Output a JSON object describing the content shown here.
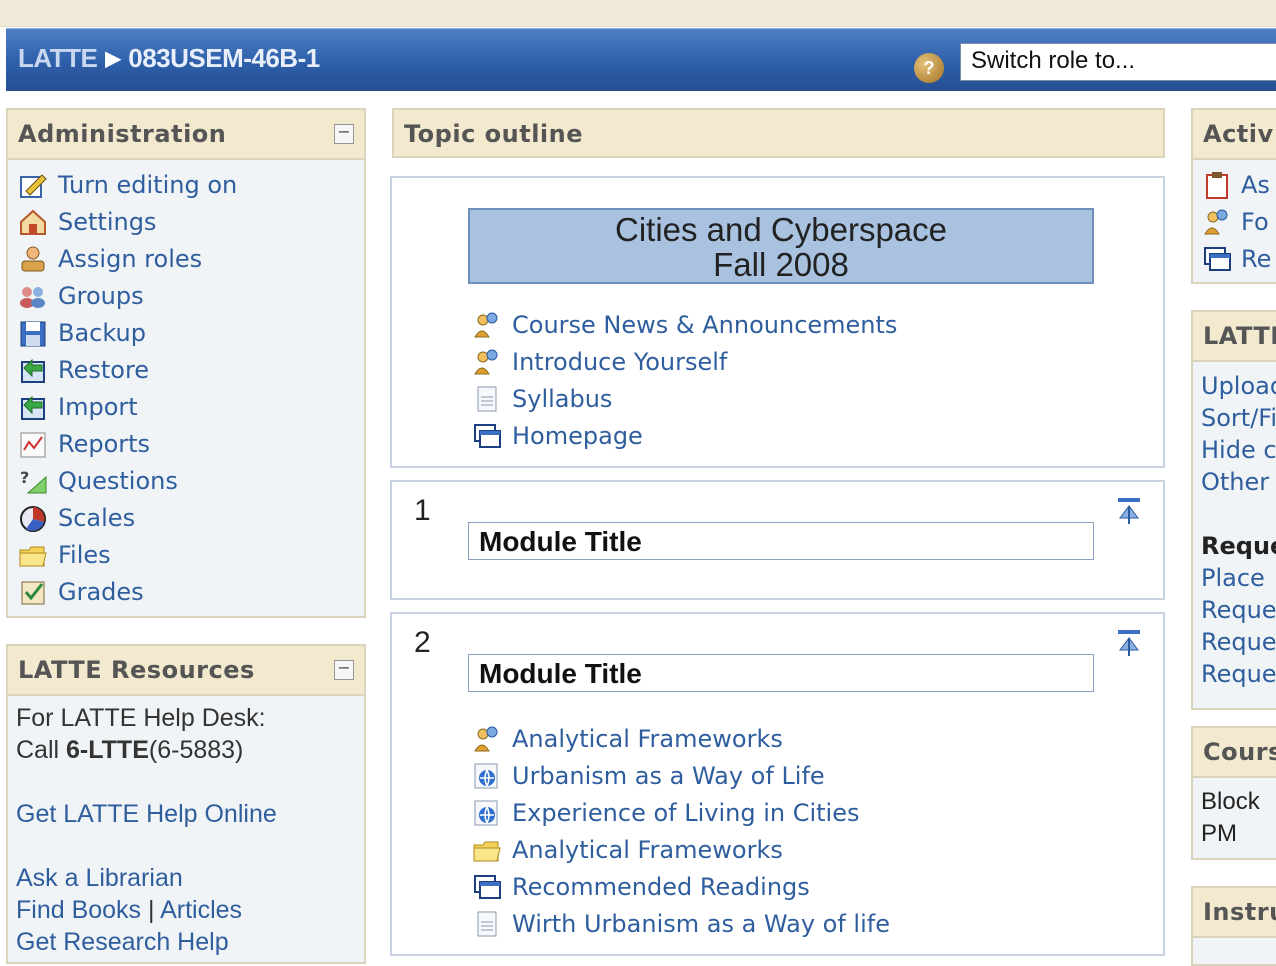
{
  "navbar": {
    "crumb_home": "LATTE",
    "crumb_separator": "▶",
    "crumb_course": "083USEM-46B-1",
    "help_icon": "?",
    "switch_role": "Switch role to..."
  },
  "admin": {
    "title": "Administration",
    "collapse": "−",
    "items": [
      {
        "label": "Turn editing on",
        "icon": "edit-icon"
      },
      {
        "label": "Settings",
        "icon": "settings-icon"
      },
      {
        "label": "Assign roles",
        "icon": "roles-icon"
      },
      {
        "label": "Groups",
        "icon": "groups-icon"
      },
      {
        "label": "Backup",
        "icon": "backup-icon"
      },
      {
        "label": "Restore",
        "icon": "restore-icon"
      },
      {
        "label": "Import",
        "icon": "import-icon"
      },
      {
        "label": "Reports",
        "icon": "reports-icon"
      },
      {
        "label": "Questions",
        "icon": "questions-icon"
      },
      {
        "label": "Scales",
        "icon": "scales-icon"
      },
      {
        "label": "Files",
        "icon": "folder-icon"
      },
      {
        "label": "Grades",
        "icon": "grades-icon"
      }
    ]
  },
  "resources": {
    "title": "LATTE Resources",
    "collapse": "−",
    "helpdesk_line1": "For LATTE Help Desk:",
    "call_prefix": "Call ",
    "call_number": "6-LTTE",
    "call_suffix": "(6-5883)",
    "help_online": "Get LATTE Help Online",
    "ask_librarian": "Ask a Librarian",
    "find_books": "Find Books",
    "pipe": " | ",
    "articles": "Articles",
    "research_help": "Get Research Help"
  },
  "topic": {
    "title": "Topic outline",
    "course_title_line1": "Cities and Cyberspace",
    "course_title_line2": "Fall 2008",
    "section0_items": [
      {
        "label": "Course News & Announcements",
        "icon": "forum-icon"
      },
      {
        "label": "Introduce Yourself",
        "icon": "forum-icon"
      },
      {
        "label": "Syllabus",
        "icon": "document-icon"
      },
      {
        "label": "Homepage",
        "icon": "resource-window-icon"
      }
    ],
    "section1": {
      "number": "1",
      "module_title": "Module Title"
    },
    "section2": {
      "number": "2",
      "module_title": "Module Title",
      "items": [
        {
          "label": "Analytical Frameworks",
          "icon": "forum-icon"
        },
        {
          "label": "Urbanism as a Way of Life",
          "icon": "web-link-icon"
        },
        {
          "label": "Experience of Living in Cities",
          "icon": "web-link-icon"
        },
        {
          "label": "Analytical Frameworks",
          "icon": "folder-icon"
        },
        {
          "label": "Recommended Readings",
          "icon": "resource-window-icon"
        },
        {
          "label": "Wirth Urbanism as a Way of life",
          "icon": "document-icon"
        }
      ]
    }
  },
  "right": {
    "activities_title": "Activ",
    "activities": [
      {
        "label": "As",
        "icon": "assignment-icon"
      },
      {
        "label": "Fo",
        "icon": "forum-icon"
      },
      {
        "label": "Re",
        "icon": "resource-window-icon"
      }
    ],
    "latte_title": "LATTE",
    "latte_links": [
      "Upload",
      "Sort/Fi",
      "Hide c",
      "Other"
    ],
    "requests_heading": "Reque",
    "requests_links": [
      "Place",
      "Reque",
      "Reque",
      "Reque"
    ],
    "course_title": "Cours",
    "course_lines": [
      "Block",
      "PM"
    ],
    "instructor_title": "Instru"
  }
}
